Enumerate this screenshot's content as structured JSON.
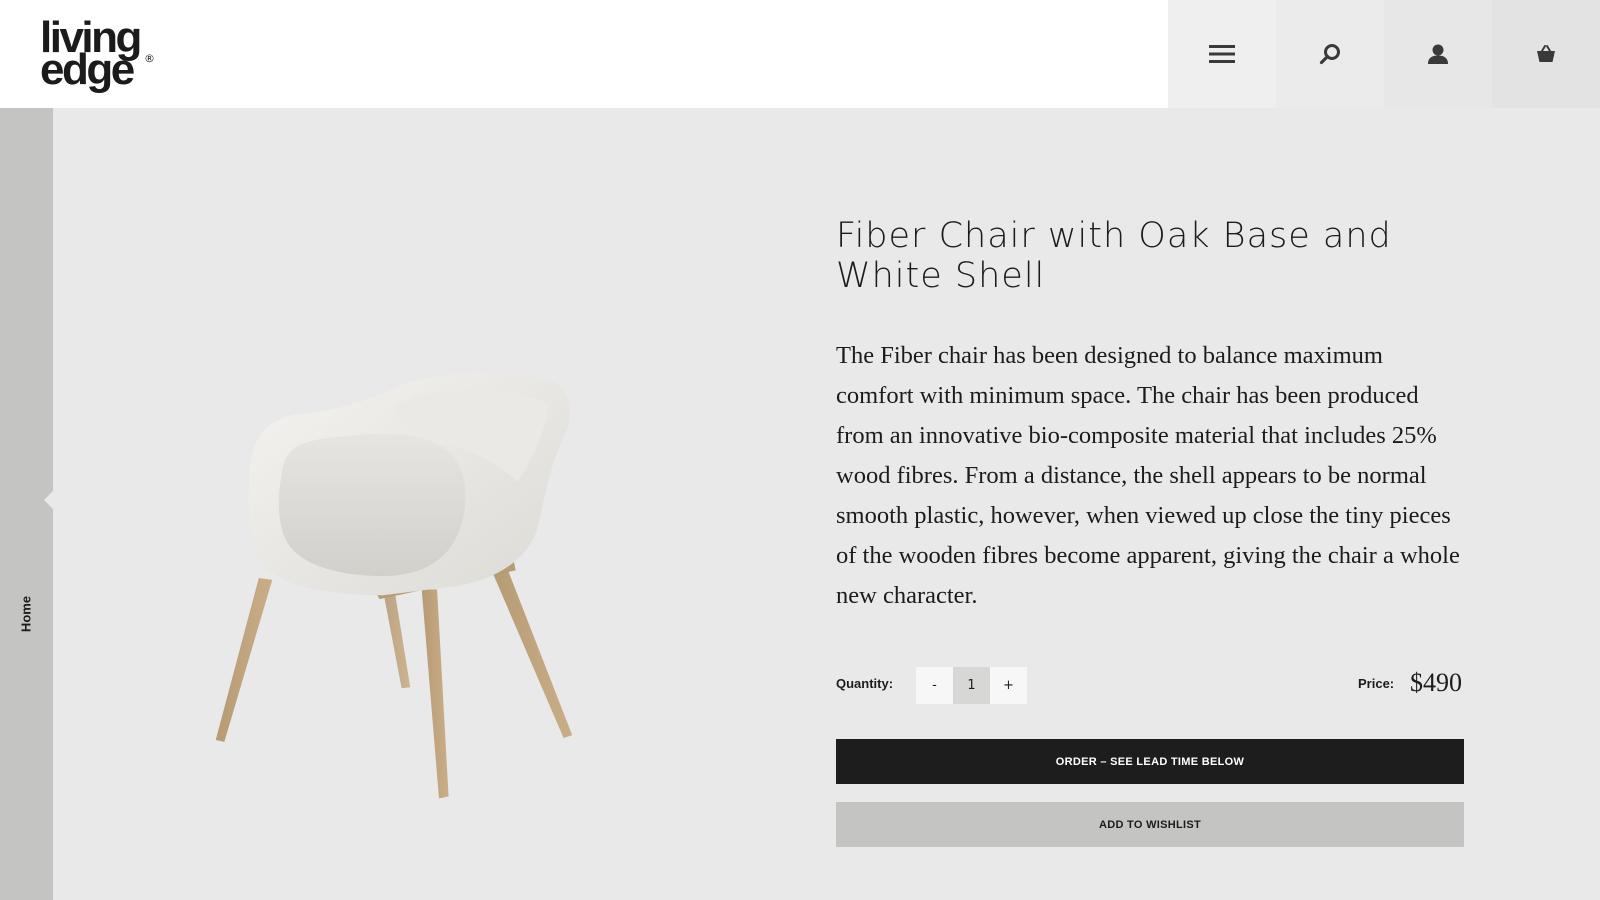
{
  "header": {
    "logo": {
      "line1": "living",
      "line2": "edge",
      "reg": "®"
    },
    "icons": [
      "menu-icon",
      "search-icon",
      "user-icon",
      "cart-icon"
    ]
  },
  "side_rail": {
    "label": "Home"
  },
  "product": {
    "title": "Fiber Chair with Oak Base and White Shell",
    "description": "The Fiber chair has been designed to balance maximum comfort with minimum space. The chair has been produced from an innovative bio-composite material that includes 25% wood fibres. From a distance, the shell appears to be normal smooth plastic, however, when viewed up close the tiny pieces of the wooden fibres become apparent, giving the chair a whole new character.",
    "quantity_label": "Quantity:",
    "quantity": {
      "minus": "-",
      "value": "1",
      "plus": "+"
    },
    "price_label": "Price:",
    "price": "$490",
    "order_button": "ORDER – SEE LEAD TIME BELOW",
    "wishlist_button": "ADD TO WISHLIST"
  },
  "colors": {
    "background": "#e9e9ea",
    "rail": "#c4c4c2",
    "primary_button": "#1d1d1d",
    "secondary_button": "#c4c4c2"
  }
}
